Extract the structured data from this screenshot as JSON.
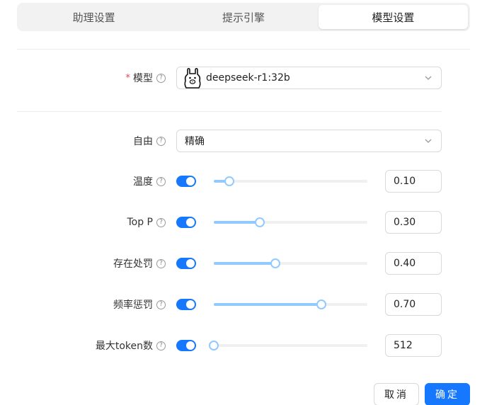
{
  "tabs": [
    {
      "label": "助理设置",
      "active": false
    },
    {
      "label": "提示引擎",
      "active": false
    },
    {
      "label": "模型设置",
      "active": true
    }
  ],
  "model": {
    "label": "模型",
    "required_mark": "*",
    "value": "deepseek-r1:32b",
    "icon": "ollama-llama-icon"
  },
  "freedom": {
    "label": "自由",
    "value": "精确"
  },
  "params": [
    {
      "label": "温度",
      "enabled": true,
      "value": "0.10",
      "fraction": 0.1
    },
    {
      "label": "Top P",
      "enabled": true,
      "value": "0.30",
      "fraction": 0.3
    },
    {
      "label": "存在处罚",
      "enabled": true,
      "value": "0.40",
      "fraction": 0.4
    },
    {
      "label": "频率惩罚",
      "enabled": true,
      "value": "0.70",
      "fraction": 0.7
    },
    {
      "label": "最大token数",
      "enabled": true,
      "value": "512",
      "fraction": 0.0
    }
  ],
  "buttons": {
    "cancel": "取消",
    "ok": "确定"
  },
  "colors": {
    "primary": "#1677ff",
    "slider_fill": "#91caff",
    "required": "#e5484d"
  }
}
